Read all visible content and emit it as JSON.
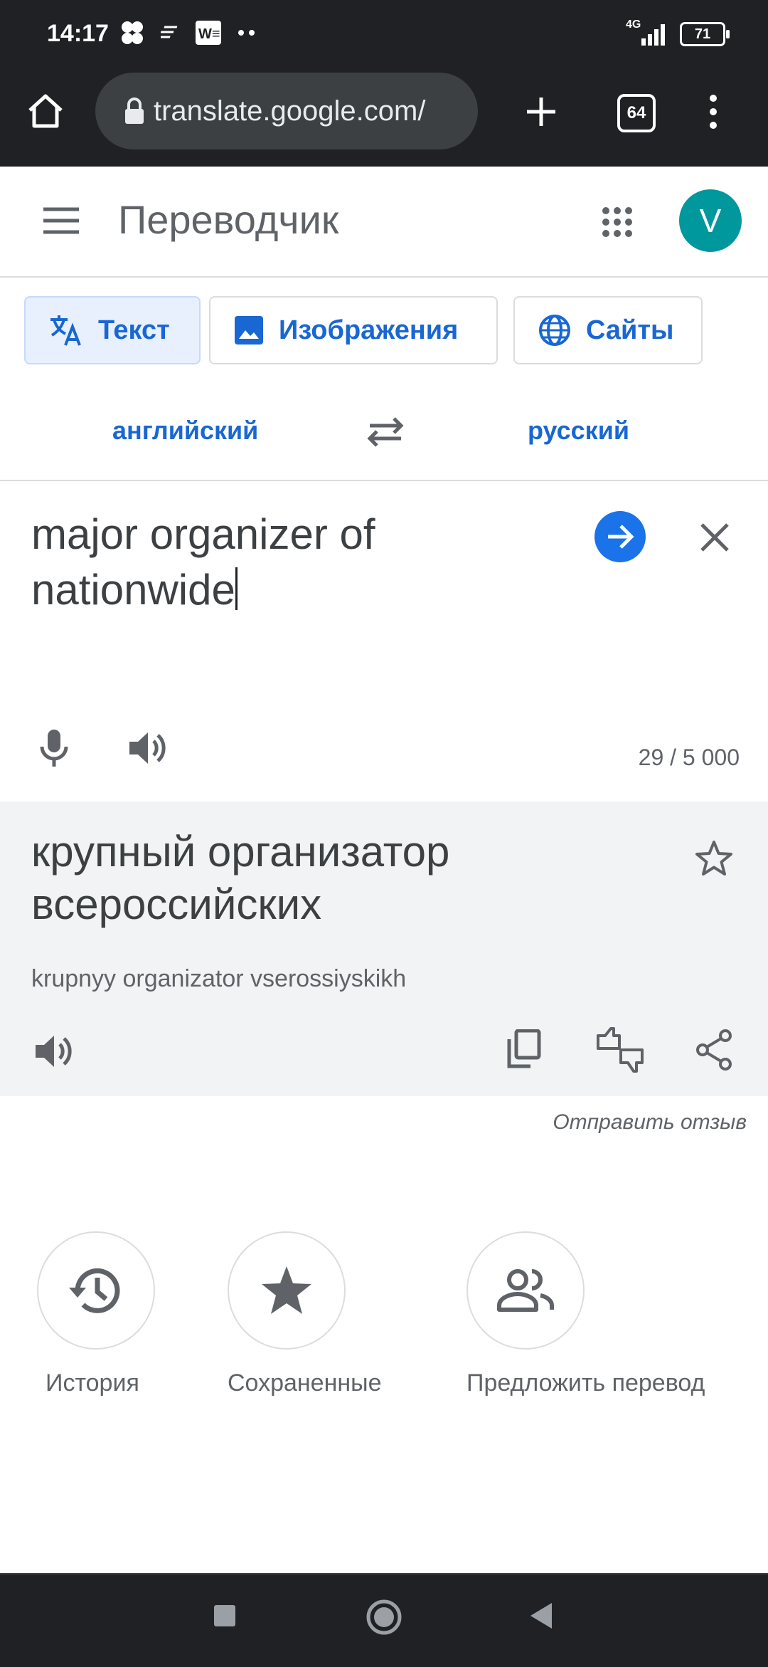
{
  "status_bar": {
    "time": "14:17",
    "network": "4G",
    "battery": "71"
  },
  "browser": {
    "url": "translate.google.com/",
    "tab_count": "64"
  },
  "app": {
    "title": "Переводчик",
    "avatar_letter": "V"
  },
  "mode_tabs": [
    {
      "label": "Текст",
      "icon": "translate-icon",
      "active": true
    },
    {
      "label": "Изображения",
      "icon": "image-icon",
      "active": false
    },
    {
      "label": "Сайты",
      "icon": "globe-icon",
      "active": false
    }
  ],
  "languages": {
    "source": "английский",
    "target": "русский"
  },
  "source": {
    "text": "major organizer of nationwide",
    "char_count": "29 / 5 000"
  },
  "translation": {
    "text": "крупный организатор всероссийских",
    "transliteration": "krupnyy organizator vserossiyskikh"
  },
  "feedback_link": "Отправить отзыв",
  "actions": [
    {
      "label": "История",
      "icon": "history-icon"
    },
    {
      "label": "Сохраненные",
      "icon": "star-icon"
    },
    {
      "label": "Предложить перевод",
      "icon": "people-icon"
    }
  ],
  "colors": {
    "accent": "#1a73e8",
    "avatar": "#00979d",
    "dark_bar": "#202124"
  }
}
